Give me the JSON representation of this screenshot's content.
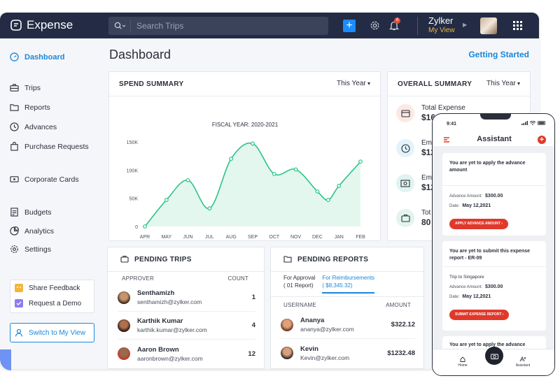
{
  "app": {
    "name": "Expense"
  },
  "search": {
    "placeholder": "Search Trips"
  },
  "header": {
    "notif_count": "6",
    "user_name": "Zylker",
    "view_label": "My View"
  },
  "sidebar": {
    "items": [
      {
        "label": "Dashboard",
        "icon": "dashboard-icon"
      },
      {
        "label": "Trips",
        "icon": "suitcase-icon"
      },
      {
        "label": "Reports",
        "icon": "folder-icon"
      },
      {
        "label": "Advances",
        "icon": "advance-icon"
      },
      {
        "label": "Purchase Requests",
        "icon": "bag-icon"
      },
      {
        "label": "Corporate Cards",
        "icon": "card-icon"
      },
      {
        "label": "Budgets",
        "icon": "budget-icon"
      },
      {
        "label": "Analytics",
        "icon": "analytics-icon"
      },
      {
        "label": "Settings",
        "icon": "settings-icon"
      }
    ],
    "feedback": "Share Feedback",
    "demo": "Request a Demo",
    "switch": "Switch to My View"
  },
  "main": {
    "title": "Dashboard",
    "getting_started": "Getting Started"
  },
  "spend": {
    "title": "SPEND SUMMARY",
    "period": "This Year"
  },
  "overall": {
    "title": "OVERALL SUMMARY",
    "period": "This Year",
    "rows": [
      {
        "label": "Total Expense",
        "value": "$16",
        "icon": "wallet-icon",
        "bg": "#fde9e4"
      },
      {
        "label": "Em",
        "value": "$12",
        "icon": "clock-icon",
        "bg": "#e3f3fb"
      },
      {
        "label": "Em",
        "value": "$12",
        "icon": "money-icon",
        "bg": "#e0f4ef"
      },
      {
        "label": "Tot",
        "value": "80",
        "icon": "briefcase-icon",
        "bg": "#e2f4ec"
      }
    ]
  },
  "chart_data": {
    "type": "area",
    "title": "FISCAL YEAR: 2020-2021",
    "categories": [
      "APR",
      "MAY",
      "JUN",
      "JUL",
      "AUG",
      "SEP",
      "OCT",
      "NOV",
      "DEC",
      "JAN",
      "FEB"
    ],
    "values": [
      0,
      47000,
      82000,
      32000,
      120000,
      147000,
      93000,
      101000,
      62000,
      47000,
      72000,
      115000
    ],
    "x_index": [
      0,
      1,
      2,
      3,
      4,
      5,
      6,
      7,
      8,
      8.5,
      9,
      10
    ],
    "yticks": [
      "0",
      "50K",
      "100K",
      "150K"
    ],
    "ytick_values": [
      0,
      50000,
      100000,
      150000
    ],
    "ylim": [
      0,
      150000
    ],
    "color": "#2bc48a"
  },
  "pending_trips": {
    "title": "PENDING TRIPS",
    "col_approver": "APPROVER",
    "col_count": "COUNT",
    "rows": [
      {
        "name": "Senthamizh",
        "email": "senthamizh@zylker.com",
        "count": "1"
      },
      {
        "name": "Karthik Kumar",
        "email": "karthik.kumar@zylker.com",
        "count": "4"
      },
      {
        "name": "Aaron Brown",
        "email": "aaronbrown@zylker.com",
        "count": "12"
      }
    ]
  },
  "pending_reports": {
    "title": "PENDING REPORTS",
    "tab1_line1": "For Approval",
    "tab1_line2": "( 01 Report)",
    "tab2_line1": "For Reimbursements",
    "tab2_line2": "( $8,345.32)",
    "col_user": "USERNAME",
    "col_amount": "AMOUNT",
    "rows": [
      {
        "name": "Ananya",
        "email": "ananya@zylker.com",
        "amount": "$322.12"
      },
      {
        "name": "Kevin",
        "email": "Kevin@zylker.com",
        "amount": "$1232.48"
      }
    ]
  },
  "phone": {
    "time": "9:41",
    "title": "Assistant",
    "cards": [
      {
        "text": "You are yet to apply the advance amount",
        "amount_label": "Advance Amount:",
        "amount": "$300.00",
        "date_label": "Date:",
        "date": "May 12,2021",
        "button": "APPLY ADVANCE AMOUNT"
      },
      {
        "text": "You are yet to submit this expense report - ER-09",
        "trip": "Trip to Singapore",
        "amount_label": "Advance Amount:",
        "amount": "$300.00",
        "date_label": "Date:",
        "date": "May 12,2021",
        "button": "SUBMIT EXPENSE REPORT"
      },
      {
        "text": "You are yet to apply the advance"
      }
    ],
    "nav_home": "Home",
    "nav_assistant": "Assistant"
  }
}
